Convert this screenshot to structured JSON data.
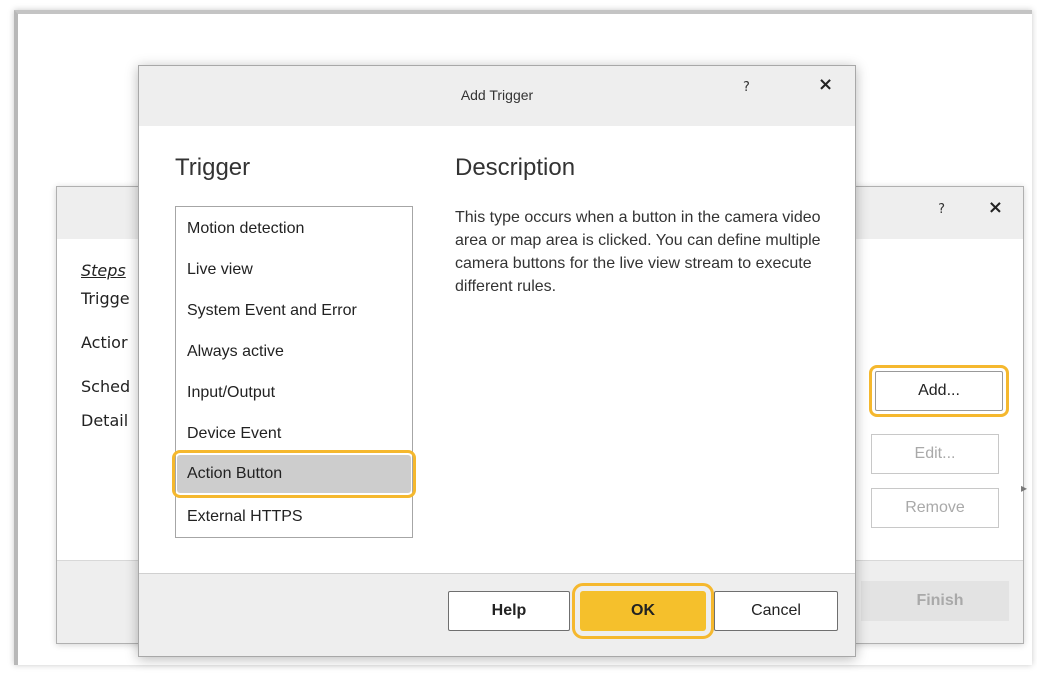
{
  "background_dialog": {
    "help_label": "?",
    "close_label": "×",
    "steps_title": "Steps",
    "steps": [
      "Trigge",
      "Actior",
      "Sched",
      "Detail"
    ],
    "add_label": "Add...",
    "edit_label": "Edit...",
    "remove_label": "Remove",
    "finish_label": "Finish"
  },
  "dialog": {
    "title": "Add Trigger",
    "help_label": "?",
    "close_label": "×",
    "trigger_heading": "Trigger",
    "description_heading": "Description",
    "triggers": [
      "Motion detection",
      "Live view",
      "System Event and Error",
      "Always active",
      "Input/Output",
      "Device Event",
      "Action Button",
      "External HTTPS"
    ],
    "selected_trigger": "Action Button",
    "description": "This type occurs when a button in the camera video area or map area is clicked. You can define multiple camera buttons for the live view stream to execute different rules.",
    "buttons": {
      "help": "Help",
      "ok": "OK",
      "cancel": "Cancel"
    }
  },
  "colors": {
    "highlight": "#f5b82e",
    "ok_button": "#f5c02c",
    "selected_row": "#cdcdcd"
  }
}
